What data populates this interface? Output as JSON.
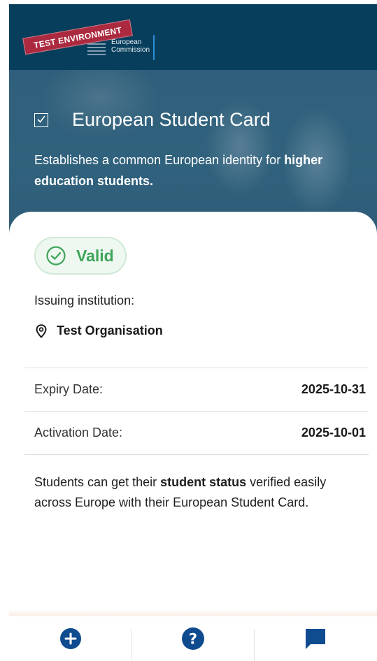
{
  "header": {
    "brand_line1": "European",
    "brand_line2": "Commission",
    "env_ribbon": "TEST ENVIRONMENT"
  },
  "hero": {
    "title": "European Student Card",
    "desc_part1": "Establishes a common European identity for ",
    "desc_bold": "higher education students."
  },
  "card": {
    "status": "Valid",
    "issuing_label": "Issuing institution:",
    "org_name": "Test Organisation",
    "rows": [
      {
        "label": "Expiry Date:",
        "value": "2025-10-31"
      },
      {
        "label": "Activation Date:",
        "value": "2025-10-01"
      }
    ],
    "footer_part1": "Students can get their ",
    "footer_bold": "student status",
    "footer_part2": " verified easily across Europe with their European Student Card."
  },
  "nav": {
    "icons": [
      "add-circle-icon",
      "help-circle-icon",
      "chat-icon"
    ]
  },
  "colors": {
    "header_bg": "#073e5c",
    "accent_blue": "#0f4b8f",
    "valid_green": "#3fa45a"
  }
}
